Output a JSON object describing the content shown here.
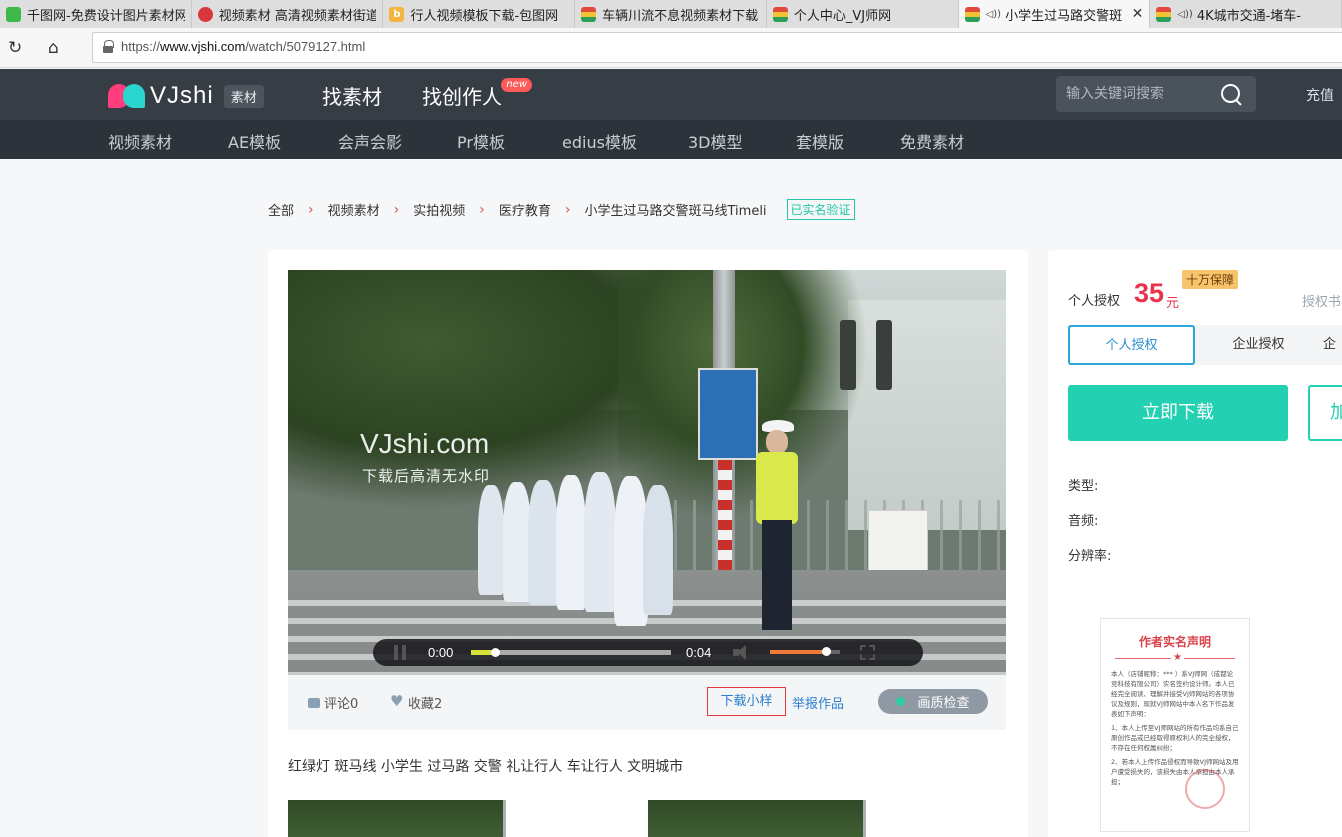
{
  "browser": {
    "tabs": [
      {
        "title": "千图网-免费设计图片素材网",
        "favicon": "qiantu-favicon-icon",
        "audio": false,
        "active": false
      },
      {
        "title": "视频素材 高清视频素材街道",
        "favicon": "vjshi-favicon-icon",
        "audio": false,
        "active": false
      },
      {
        "title": "行人视频模板下载-包图网",
        "favicon": "baotu-favicon-icon",
        "audio": false,
        "active": false
      },
      {
        "title": "车辆川流不息视频素材下载",
        "favicon": "tv-favicon-icon",
        "audio": false,
        "active": false
      },
      {
        "title": "个人中心_VJ师网",
        "favicon": "tv-favicon-icon",
        "audio": false,
        "active": false
      },
      {
        "title": "小学生过马路交警斑",
        "favicon": "tv-favicon-icon",
        "audio": true,
        "active": true
      },
      {
        "title": "4K城市交通-堵车-",
        "favicon": "tv-favicon-icon",
        "audio": true,
        "active": false
      }
    ],
    "url_prefix": "https://",
    "url_host": "www.vjshi.com",
    "url_path": "/watch/5079127.html"
  },
  "header": {
    "logo_text": "VJshi",
    "logo_badge": "素材",
    "nav": [
      {
        "label": "找素材",
        "active": true
      },
      {
        "label": "找创作人",
        "badge": "new"
      }
    ],
    "search_placeholder": "输入关键词搜索",
    "recharge": "充值"
  },
  "subnav": [
    "视频素材",
    "AE模板",
    "会声会影",
    "Pr模板",
    "edius模板",
    "3D模型",
    "套模版",
    "免费素材"
  ],
  "breadcrumb": [
    "全部",
    "视频素材",
    "实拍视频",
    "医疗教育",
    "小学生过马路交警斑马线Timeli"
  ],
  "verified_badge": "已实名验证",
  "video": {
    "watermark": "VJshi.com",
    "watermark_sub": "下载后高清无水印",
    "current_time": "0:00",
    "duration": "0:04",
    "progress": 0.12,
    "volume": 0.8
  },
  "actions": {
    "comments": "评论0",
    "favorites": "收藏2",
    "download_sample": "下载小样",
    "report": "举报作品",
    "quality_check": "画质检查"
  },
  "tags": "红绿灯 斑马线 小学生 过马路 交警 礼让行人 车让行人 文明城市",
  "side": {
    "price_label": "个人授权",
    "price": "35",
    "price_unit": "元",
    "guarantee": "十万保障",
    "license_doc": "授权书",
    "license_tabs": [
      "个人授权",
      "企业授权",
      "企"
    ],
    "download_now": "立即下载",
    "add_label": "加",
    "meta": [
      "类型:",
      "音频:",
      "分辨率:"
    ],
    "declaration": {
      "title": "作者实名声明",
      "body": [
        "本人（店铺昵称：*** ）系VJ师网（成都论竞科技有限公司）实名签约设计师。本人已经完全阅读、理解并接受VJ师网站的各项协议及规则，现就VJ师网站中本人名下作品发表如下声明：",
        "1、本人上传至VJ师网站的所有作品均系自己原创作品或已经取得原权利人的完全授权，不存在任何权属纠纷；",
        "2、若本人上传作品侵权而导致VJ师网站及用户遭受损失的，该损失由本人承担由本人承担；"
      ]
    }
  }
}
